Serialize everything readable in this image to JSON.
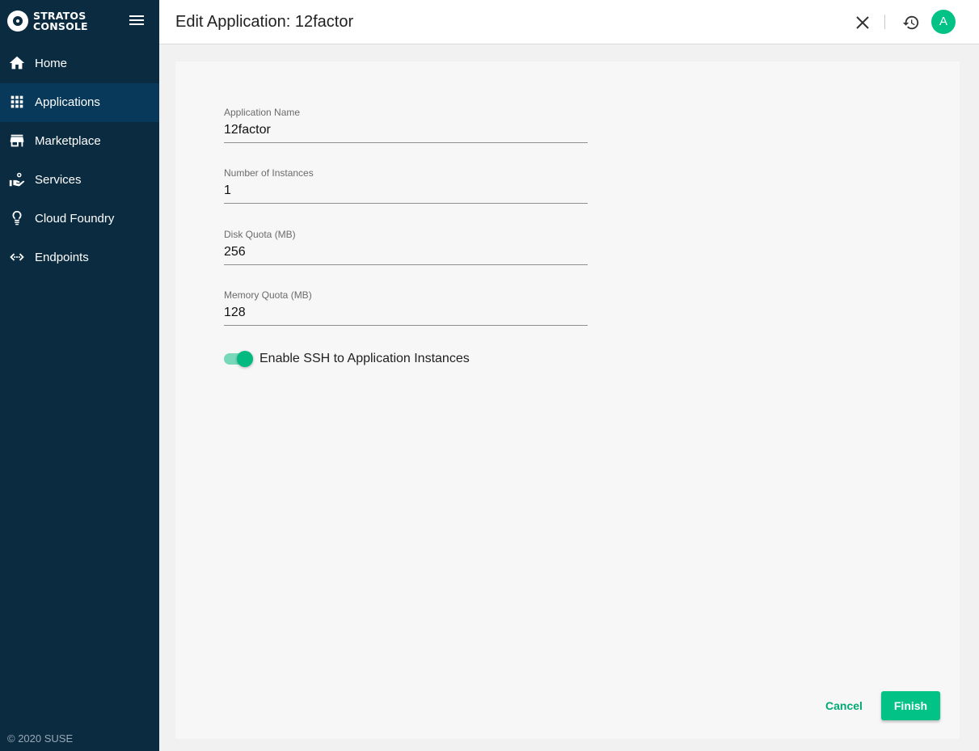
{
  "brand": {
    "line1": "STRATOS",
    "line2": "CONSOLE",
    "logo_icon": "stratos-logo-icon"
  },
  "sidebar": {
    "menu_icon": "menu-icon",
    "items": [
      {
        "label": "Home",
        "icon": "home-icon",
        "active": false
      },
      {
        "label": "Applications",
        "icon": "apps-grid-icon",
        "active": true
      },
      {
        "label": "Marketplace",
        "icon": "store-icon",
        "active": false
      },
      {
        "label": "Services",
        "icon": "service-hand-icon",
        "active": false
      },
      {
        "label": "Cloud Foundry",
        "icon": "cloud-foundry-icon",
        "active": false
      },
      {
        "label": "Endpoints",
        "icon": "endpoints-icon",
        "active": false
      }
    ],
    "copyright": "© 2020 SUSE"
  },
  "header": {
    "title": "Edit Application: 12factor",
    "close_icon": "close-icon",
    "history_icon": "history-icon",
    "avatar_letter": "A"
  },
  "form": {
    "app_name": {
      "label": "Application Name",
      "value": "12factor"
    },
    "instances": {
      "label": "Number of Instances",
      "value": "1"
    },
    "disk_quota": {
      "label": "Disk Quota (MB)",
      "value": "256"
    },
    "memory_quota": {
      "label": "Memory Quota (MB)",
      "value": "128"
    },
    "ssh": {
      "label": "Enable SSH to Application Instances",
      "enabled": true
    }
  },
  "actions": {
    "cancel_label": "Cancel",
    "finish_label": "Finish"
  },
  "colors": {
    "sidebar_bg": "#0b2b40",
    "sidebar_active": "#08395a",
    "accent": "#02c385"
  }
}
